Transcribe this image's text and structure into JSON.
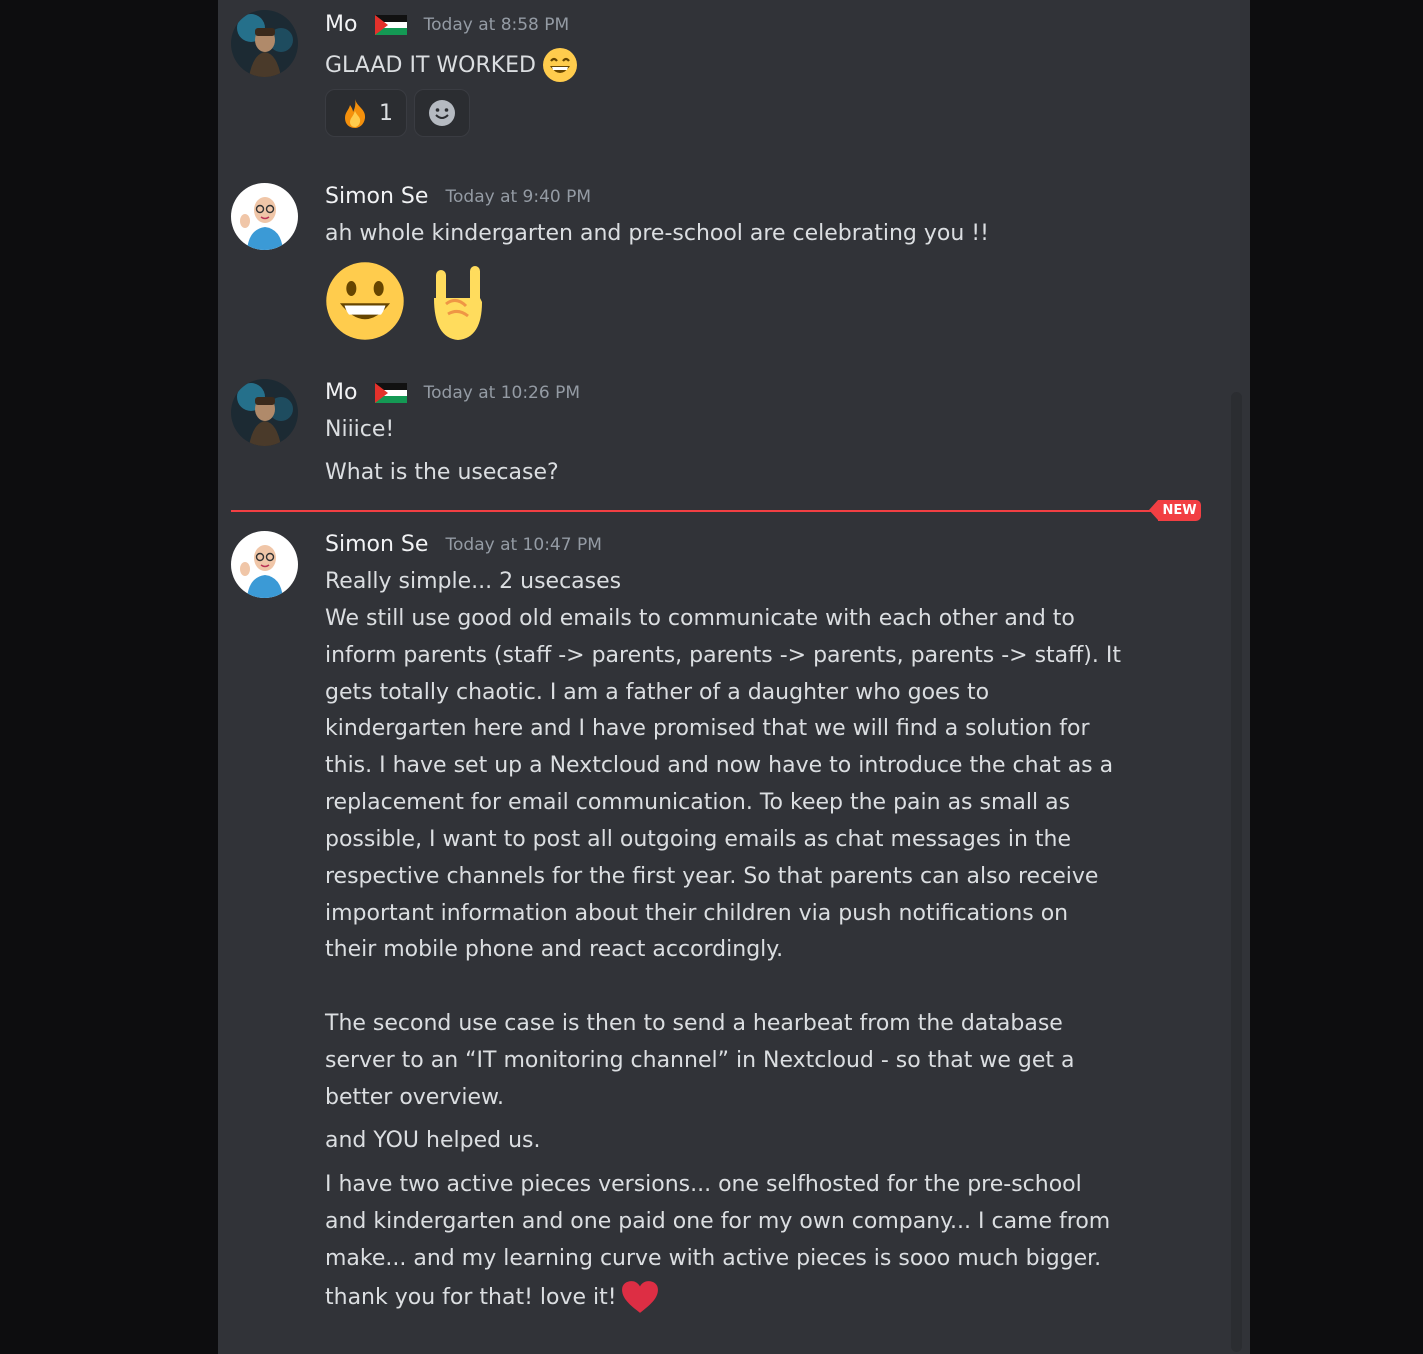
{
  "messages": [
    {
      "author": "Mo",
      "timestamp": "Today at 8:58 PM",
      "lines": [
        "GLAAD IT WORKED"
      ],
      "reactions": [
        {
          "emoji": "fire-emoji",
          "count": "1"
        }
      ]
    },
    {
      "author": "Simon Se",
      "timestamp": "Today at 9:40 PM",
      "lines": [
        "ah whole kindergarten and pre-school are celebrating you !!"
      ]
    },
    {
      "author": "Mo",
      "timestamp": "Today at 10:26 PM",
      "lines": [
        "Niiice!",
        "What is the usecase?"
      ]
    },
    {
      "author": "Simon Se",
      "timestamp": "Today at 10:47 PM",
      "lines": [
        "Really simple...  2 usecases",
        "We still use good old emails to communicate with each other and to",
        "inform parents (staff -> parents, parents -> parents, parents -> staff). It",
        "gets totally chaotic.  I am a father of a daughter who goes to",
        "kindergarten here and I have promised that we will find a solution for",
        "this. I have set up a Nextcloud and now have to introduce the chat as a",
        "replacement for email communication.  To keep the pain as small as",
        "possible, I want to post all outgoing emails as chat messages in the",
        "respective channels for the first year.  So that parents can also receive",
        "important information about their children via push notifications on",
        "their mobile phone and react accordingly.",
        "The second use case is then to send a hearbeat from the database",
        "server to an “IT monitoring channel” in Nextcloud - so that we get a",
        "better overview.",
        "and YOU helped us.",
        "I have two active pieces versions... one selfhosted for the pre-school",
        "and kindergarten and one paid one for my own company...    I came from",
        "make... and my learning curve with active pieces is sooo much bigger.",
        "thank you for that! love it!"
      ]
    }
  ],
  "new_divider_label": "NEW",
  "colors": {
    "background": "#313338",
    "outer": "#0d0d0f",
    "username": "#f2f3f5",
    "timestamp": "#949ba4",
    "text": "#dbdee1",
    "new_red": "#f23f43"
  }
}
